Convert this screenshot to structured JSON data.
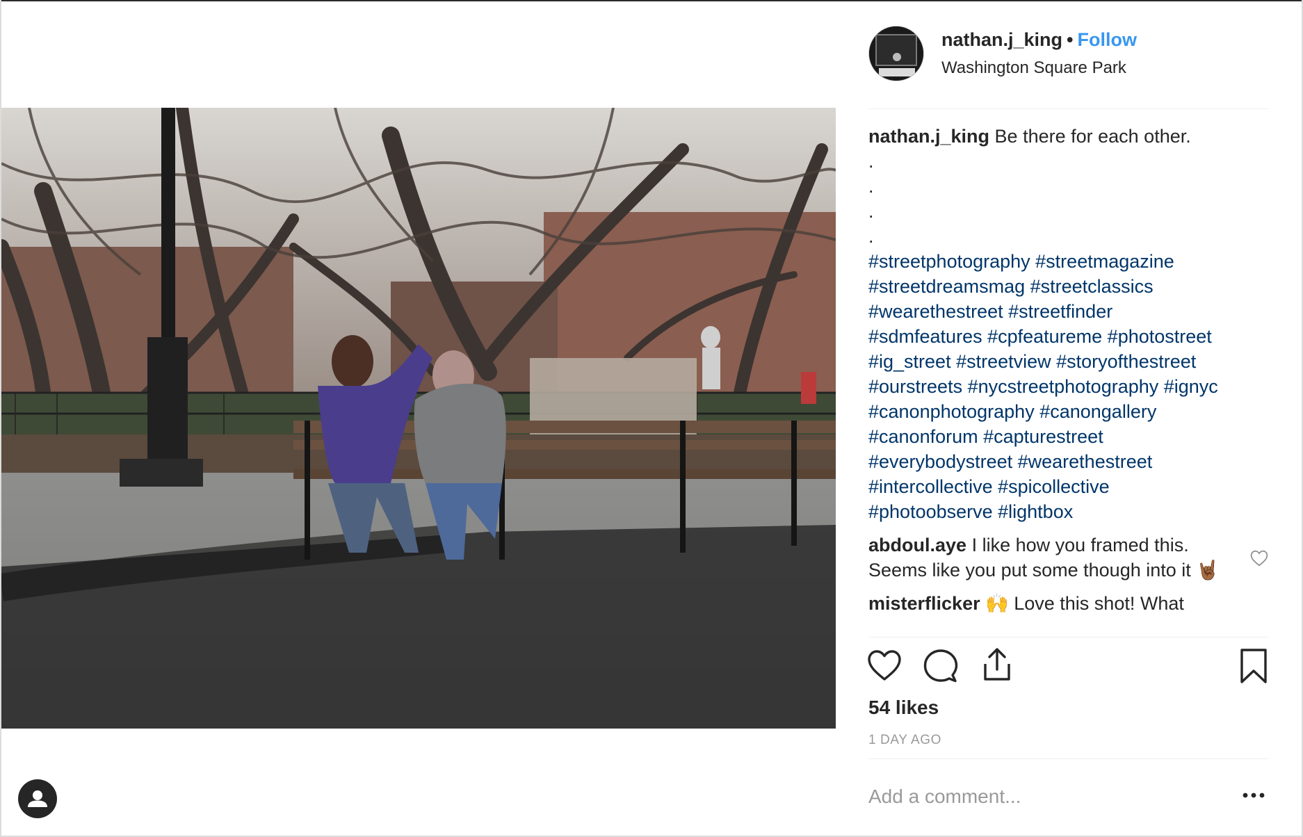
{
  "post": {
    "username": "nathan.j_king",
    "separator": "•",
    "follow_label": "Follow",
    "location": "Washington Square Park",
    "caption_text": "Be there for each other.",
    "caption_dots": [
      ".",
      ".",
      ".",
      "."
    ],
    "hashtag_lines": [
      "#streetphotography #streetmagazine",
      "#streetdreamsmag #streetclassics",
      "#wearethestreet #streetfinder",
      "#sdmfeatures #cpfeatureme #photostreet",
      "#ig_street #streetview #storyofthestreet",
      "#ourstreets #nycstreetphotography #ignyc",
      "#canonphotography #canongallery",
      "#canonforum #capturestreet",
      "#everybodystreet #wearethestreet",
      "#intercollective #spicollective",
      "#photoobserve #lightbox"
    ],
    "likes": "54 likes",
    "time_ago": "1 DAY AGO"
  },
  "comments": [
    {
      "user": "abdoul.aye",
      "text": "I like how you framed this. Seems like you put some though into it 🤘🏾"
    },
    {
      "user": "misterflicker",
      "text": "🙌 Love this shot! What"
    }
  ],
  "comment_box": {
    "placeholder": "Add a comment..."
  },
  "icons": {
    "like": "heart-icon",
    "comment": "comment-icon",
    "share": "share-icon",
    "save": "bookmark-icon",
    "more": "more-options-icon",
    "comment_like": "heart-icon",
    "account": "user-icon"
  },
  "colors": {
    "link_blue": "#3897f0",
    "hashtag": "#003569",
    "muted": "#999999",
    "text": "#262626"
  }
}
